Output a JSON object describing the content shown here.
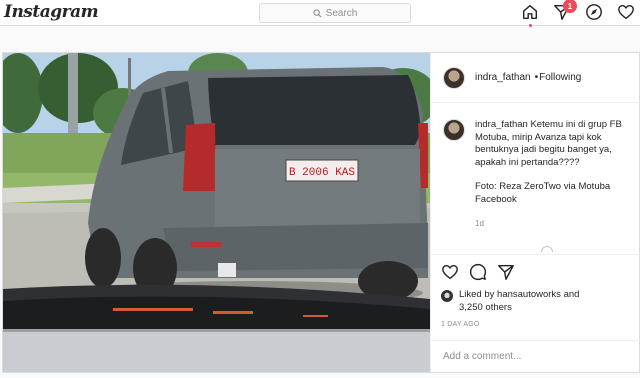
{
  "header": {
    "logo_text": "Instagram",
    "search_placeholder": "Search",
    "notification_count": "1",
    "icons": [
      "home-icon",
      "direct-message-icon",
      "explore-icon",
      "activity-heart-icon"
    ]
  },
  "post": {
    "author": {
      "username": "indra_fathan",
      "separator": "•",
      "follow_status": "Following"
    },
    "photo": {
      "plate_text": "B 2006 KAS"
    },
    "caption": {
      "username": "indra_fathan",
      "text_main": "Ketemu ini di grup FB Motuba, mirip Avanza tapi kok bentuknya jadi begitu banget ya, apakah ini pertanda????",
      "text_credit": "Foto: Reza ZeroTwo via Motuba Facebook",
      "age": "1d"
    },
    "likes": {
      "prefix": "Liked by ",
      "liker": "hansautoworks",
      "joiner": " and ",
      "others": "3,250 others"
    },
    "timestamp": "1 DAY AGO",
    "comment_placeholder": "Add a comment..."
  },
  "colors": {
    "accent_red": "#ed4956",
    "border": "#dbdbdb",
    "muted_text": "#8e8e8e"
  }
}
